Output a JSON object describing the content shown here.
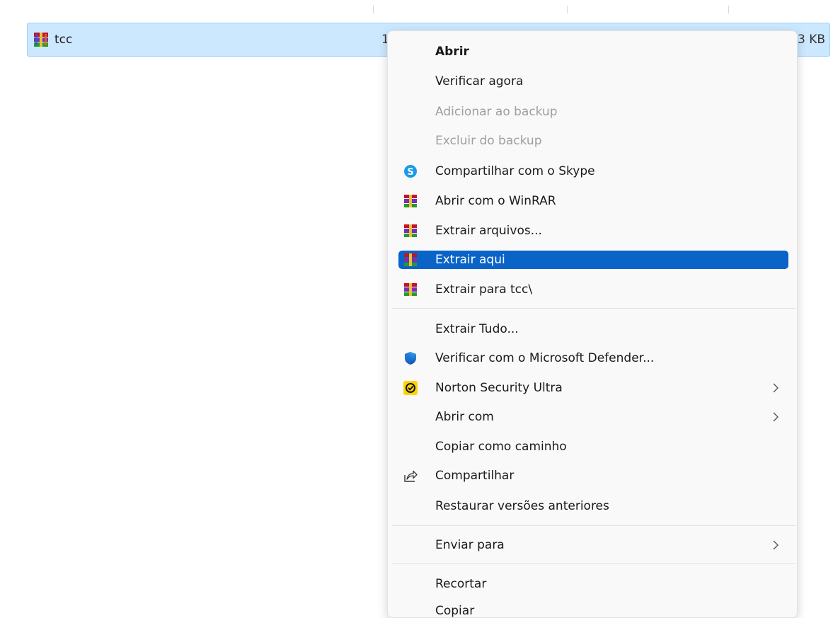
{
  "file": {
    "name": "tcc",
    "date_fragment": "1",
    "size": "3 KB",
    "icon": "winrar-archive-icon"
  },
  "menu": {
    "items": [
      {
        "label": "Abrir",
        "icon": "",
        "bold": true
      },
      {
        "label": "Verificar agora",
        "icon": ""
      },
      {
        "label": "Adicionar ao backup",
        "icon": "",
        "disabled": true
      },
      {
        "label": "Excluir do backup",
        "icon": "",
        "disabled": true
      },
      {
        "label": "Compartilhar com o Skype",
        "icon": "skype-icon"
      },
      {
        "label": "Abrir com o WinRAR",
        "icon": "winrar-icon"
      },
      {
        "label": "Extrair arquivos...",
        "icon": "winrar-icon"
      },
      {
        "label": "Extrair aqui",
        "icon": "winrar-icon",
        "highlighted": true
      },
      {
        "label": "Extrair para tcc\\",
        "icon": "winrar-icon"
      },
      {
        "label": "Extrair Tudo...",
        "icon": ""
      },
      {
        "label": "Verificar com o Microsoft Defender...",
        "icon": "defender-shield-icon"
      },
      {
        "label": "Norton Security Ultra",
        "icon": "norton-icon",
        "submenu": true
      },
      {
        "label": "Abrir com",
        "icon": "",
        "submenu": true
      },
      {
        "label": "Copiar como caminho",
        "icon": ""
      },
      {
        "label": "Compartilhar",
        "icon": "share-icon"
      },
      {
        "label": "Restaurar versões anteriores",
        "icon": ""
      },
      {
        "label": "Enviar para",
        "icon": "",
        "submenu": true
      },
      {
        "label": "Recortar",
        "icon": ""
      },
      {
        "label": "Copiar",
        "icon": ""
      }
    ]
  },
  "colors": {
    "selection_background": "#cce8ff",
    "selection_border": "#99d1ff",
    "menu_highlight": "#0a64c8",
    "disabled_text": "#9e9e9e"
  }
}
